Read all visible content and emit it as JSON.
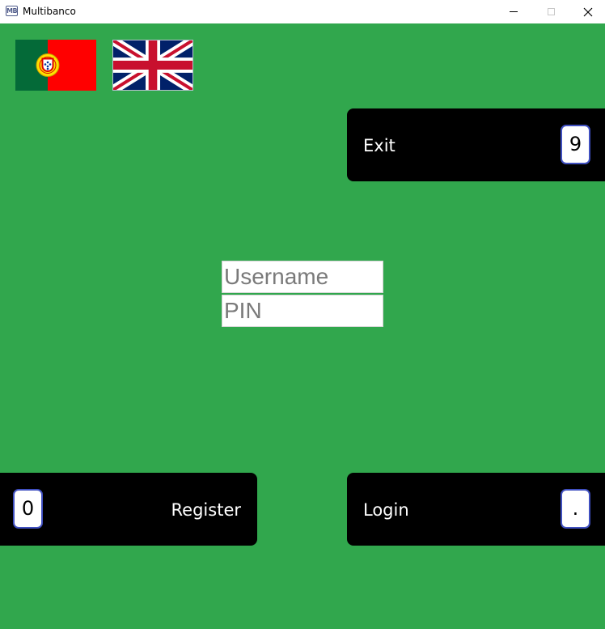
{
  "window": {
    "title": "Multibanco",
    "icon_label": "MB",
    "controls": {
      "minimize": "—",
      "maximize": "☐",
      "close": "✕"
    }
  },
  "flags": [
    {
      "name": "Portuguese",
      "icon": "flag-portugal-icon"
    },
    {
      "name": "English",
      "icon": "flag-uk-icon"
    }
  ],
  "exit": {
    "label": "Exit",
    "key": "9"
  },
  "register": {
    "label": "Register",
    "key": "0"
  },
  "login": {
    "label": "Login",
    "key": "."
  },
  "form": {
    "username_placeholder": "Username",
    "username_value": "",
    "pin_placeholder": "PIN",
    "pin_value": ""
  },
  "colors": {
    "background": "#31a74d",
    "panel": "#000000",
    "key_border": "#4050c0"
  }
}
